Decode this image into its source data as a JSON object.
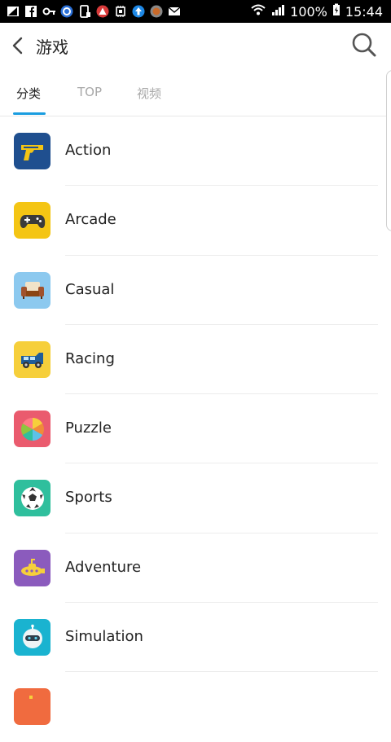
{
  "status_bar": {
    "battery": "100%",
    "time": "15:44"
  },
  "app_bar": {
    "title": "游戏"
  },
  "tabs": [
    {
      "label": "分类",
      "active": true
    },
    {
      "label": "TOP",
      "active": false
    },
    {
      "label": "视频",
      "active": false
    }
  ],
  "categories": [
    {
      "label": "Action",
      "icon": "pistol-icon",
      "color": "#1f4f8f"
    },
    {
      "label": "Arcade",
      "icon": "gamepad-icon",
      "color": "#f4c514"
    },
    {
      "label": "Casual",
      "icon": "sofa-icon",
      "color": "#8cc9ef"
    },
    {
      "label": "Racing",
      "icon": "jeep-icon",
      "color": "#f6cf3b"
    },
    {
      "label": "Puzzle",
      "icon": "puzzle-wheel-icon",
      "color": "#ea5b6e"
    },
    {
      "label": "Sports",
      "icon": "soccer-ball-icon",
      "color": "#2fbf9d"
    },
    {
      "label": "Adventure",
      "icon": "submarine-icon",
      "color": "#8b5bbd"
    },
    {
      "label": "Simulation",
      "icon": "robot-icon",
      "color": "#1ab3d0"
    },
    {
      "label": "",
      "icon": "partial-icon",
      "color": "#f06b3f"
    }
  ],
  "colors": {
    "accent": "#1a9de0",
    "text": "#222222",
    "muted": "#a8a8a8"
  }
}
